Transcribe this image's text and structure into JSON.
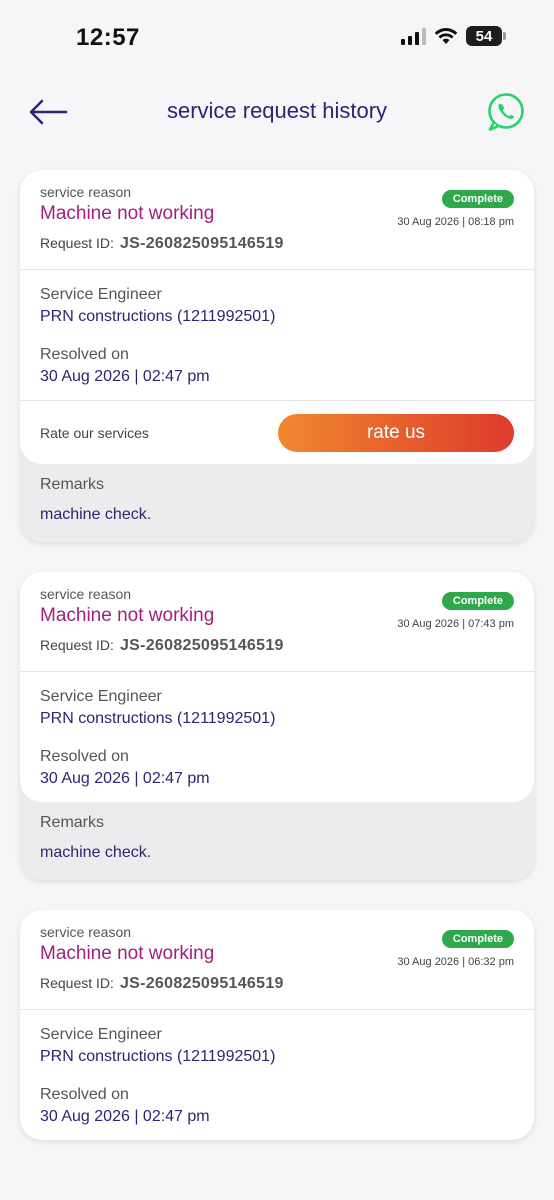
{
  "status_bar": {
    "time": "12:57",
    "battery": "54"
  },
  "header": {
    "title": "service request history"
  },
  "cards": [
    {
      "reason_label": "service reason",
      "reason": "Machine not working",
      "request_id_label": "Request ID:",
      "request_id": "JS-260825095146519",
      "status": "Complete",
      "date": "30 Aug 2026 | 08:18 pm",
      "engineer_label": "Service Engineer",
      "engineer": "PRN constructions (1211992501)",
      "resolved_label": "Resolved on",
      "resolved": "30 Aug 2026 | 02:47 pm",
      "rate_label": "Rate our services",
      "rate_button": "rate us",
      "remarks_label": "Remarks",
      "remarks": "machine check."
    },
    {
      "reason_label": "service reason",
      "reason": "Machine not working",
      "request_id_label": "Request ID:",
      "request_id": "JS-260825095146519",
      "status": "Complete",
      "date": "30 Aug 2026 | 07:43 pm",
      "engineer_label": "Service Engineer",
      "engineer": "PRN constructions (1211992501)",
      "resolved_label": "Resolved on",
      "resolved": "30 Aug 2026 | 02:47 pm",
      "remarks_label": "Remarks",
      "remarks": "machine check."
    },
    {
      "reason_label": "service reason",
      "reason": "Machine not working",
      "request_id_label": "Request ID:",
      "request_id": "JS-260825095146519",
      "status": "Complete",
      "date": "30 Aug 2026 | 06:32 pm",
      "engineer_label": "Service Engineer",
      "engineer": "PRN constructions (1211992501)",
      "resolved_label": "Resolved on",
      "resolved": "30 Aug 2026 | 02:47 pm"
    }
  ],
  "colors": {
    "title": "#2e2470",
    "reason": "#a3207a",
    "badge": "#2ea84a",
    "rate_gradient_start": "#f0882e",
    "rate_gradient_end": "#dd3a2c",
    "whatsapp": "#25d366"
  },
  "icons": {
    "back": "arrow-left-icon",
    "whatsapp": "whatsapp-icon",
    "signal": "cellular-signal-icon",
    "wifi": "wifi-icon",
    "battery": "battery-icon"
  }
}
